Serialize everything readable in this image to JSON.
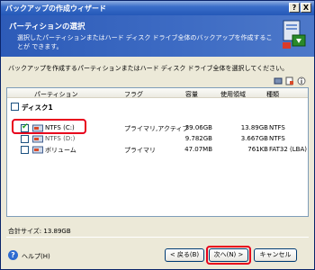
{
  "window": {
    "title": "バックアップの作成ウィザード",
    "help_button": "?",
    "close_button": "X"
  },
  "header": {
    "title": "パーティションの選択",
    "description": "選択したパーティションまたはハード ディスク ドライブ全体のバックアップを作成することが できます。"
  },
  "instruction": "バックアップを作成するパーティションまたはハード ディスク ドライブ全体を選択してください。",
  "columns": {
    "partition": "パーティション",
    "flag": "フラグ",
    "capacity": "容量",
    "used": "使用領域",
    "type": "種類"
  },
  "disk": {
    "label": "ディスク1",
    "checked": false
  },
  "partitions": [
    {
      "name": "NTFS (C:)",
      "flag": "プライマリ,アクティブ",
      "capacity": "39.06GB",
      "used": "13.89GB",
      "type": "NTFS",
      "checked": true
    },
    {
      "name": "NTFS (D:)",
      "flag": "",
      "capacity": "9.782GB",
      "used": "3.667GB",
      "type": "NTFS",
      "checked": false
    },
    {
      "name": "ボリューム",
      "flag": "プライマリ",
      "capacity": "47.07MB",
      "used": "761KB",
      "type": "FAT32 (LBA)",
      "checked": false
    }
  ],
  "total": "合計サイズ: 13.89GB",
  "footer": {
    "help": "ヘルプ(H)",
    "back": "< 戻る(B)",
    "next": "次へ(N) >",
    "cancel": "キャンセル"
  },
  "colors": {
    "header_bg": "#3e6cc4",
    "highlight": "#e8001c",
    "check": "#21a121"
  }
}
